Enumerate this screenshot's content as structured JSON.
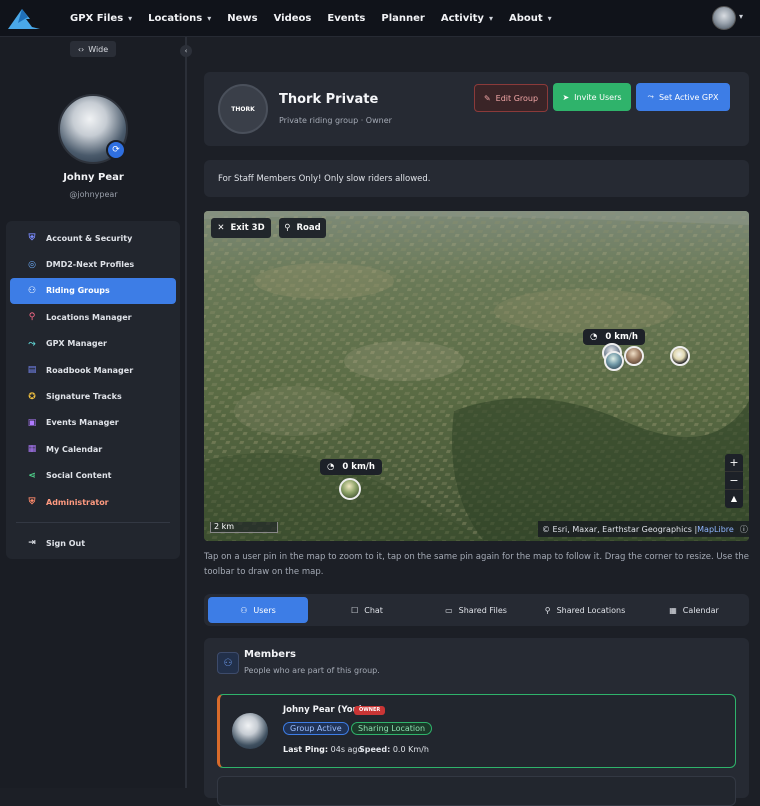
{
  "nav": {
    "items": [
      {
        "label": "GPX Files",
        "dropdown": true
      },
      {
        "label": "Locations",
        "dropdown": true
      },
      {
        "label": "News",
        "dropdown": false
      },
      {
        "label": "Videos",
        "dropdown": false
      },
      {
        "label": "Events",
        "dropdown": false
      },
      {
        "label": "Planner",
        "dropdown": false
      },
      {
        "label": "Activity",
        "dropdown": true
      },
      {
        "label": "About",
        "dropdown": true
      }
    ],
    "logo_icon": "mountain-logo-icon",
    "avatar_icon": "user-avatar-icon"
  },
  "sidebar": {
    "wide_label": "Wide",
    "profile": {
      "name": "Johny Pear",
      "handle": "@johnypear"
    },
    "items": [
      {
        "label": "Account & Security",
        "icon": "shield-icon",
        "color": "#7b8cff",
        "active": false
      },
      {
        "label": "DMD2-Next Profiles",
        "icon": "profile-circle-icon",
        "color": "#6fb0ff",
        "active": false
      },
      {
        "label": "Riding Groups",
        "icon": "users-icon",
        "color": "#ffffff",
        "active": true
      },
      {
        "label": "Locations Manager",
        "icon": "map-pin-icon",
        "color": "#ff6b8a",
        "active": false
      },
      {
        "label": "GPX Manager",
        "icon": "route-icon",
        "color": "#5fd0d0",
        "active": false
      },
      {
        "label": "Roadbook Manager",
        "icon": "book-icon",
        "color": "#7b8cff",
        "active": false
      },
      {
        "label": "Signature Tracks",
        "icon": "medal-icon",
        "color": "#f0c040",
        "active": false
      },
      {
        "label": "Events Manager",
        "icon": "calendar-plus-icon",
        "color": "#b07bff",
        "active": false
      },
      {
        "label": "My Calendar",
        "icon": "calendar-icon",
        "color": "#b07bff",
        "active": false
      },
      {
        "label": "Social Content",
        "icon": "share-icon",
        "color": "#4fd08a",
        "active": false
      },
      {
        "label": "Administrator",
        "icon": "admin-shield-icon",
        "color": "#ff8a6b",
        "active": false
      }
    ],
    "signout": {
      "label": "Sign Out",
      "icon": "sign-out-icon"
    }
  },
  "group": {
    "title": "Thork Private",
    "subtitle": "Private riding group · Owner",
    "logo_text": "THORK",
    "buttons": {
      "edit": "Edit Group",
      "invite": "Invite Users",
      "gpx": "Set Active GPX"
    }
  },
  "description": "For Staff Members Only! Only slow riders allowed.",
  "map": {
    "exit_label": "Exit 3D",
    "road_label": "Road",
    "speed_tags": [
      "0 km/h",
      "0 km/h"
    ],
    "scale_label": "2 km",
    "attribution": "© Esri, Maxar, Earthstar Geographics | ",
    "attribution_link": "MapLibre"
  },
  "help_text": "Tap on a user pin in the map to zoom to it, tap on the same pin again for the map to follow it. Drag the corner to resize. Use the toolbar to draw on the map.",
  "tabs": [
    {
      "label": "Users",
      "icon": "users-icon",
      "active": true
    },
    {
      "label": "Chat",
      "icon": "chat-icon",
      "active": false
    },
    {
      "label": "Shared Files",
      "icon": "folder-icon",
      "active": false
    },
    {
      "label": "Shared Locations",
      "icon": "location-share-icon",
      "active": false
    },
    {
      "label": "Calendar",
      "icon": "calendar-icon",
      "active": false
    }
  ],
  "members": {
    "title": "Members",
    "subtitle": "People who are part of this group.",
    "list": [
      {
        "name": "Johny Pear (You)",
        "badge": "OWNER",
        "pills": [
          "Group Active",
          "Sharing Location"
        ],
        "ping_label": "Last Ping:",
        "ping_value": "04s ago",
        "speed_label": "Speed:",
        "speed_value": "0.0 Km/h"
      }
    ]
  },
  "colors": {
    "accent": "#3d7de6",
    "success": "#2fb36b",
    "danger": "#c93535"
  }
}
